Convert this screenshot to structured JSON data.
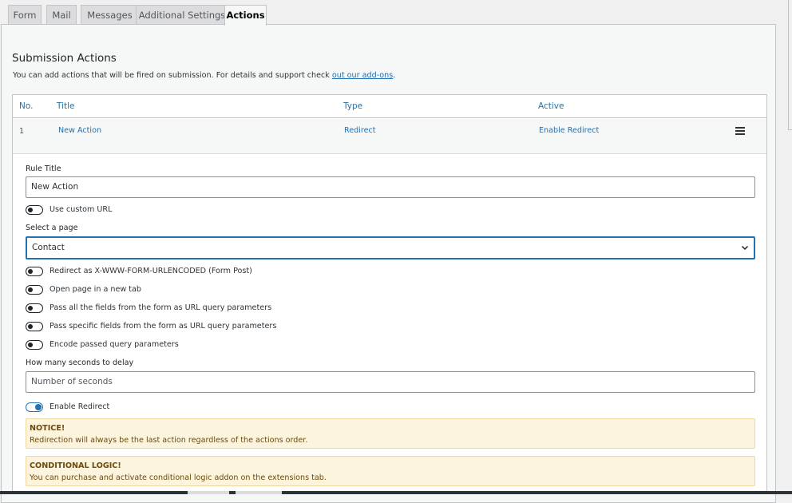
{
  "tabs": [
    {
      "label": "Form"
    },
    {
      "label": "Mail"
    },
    {
      "label": "Messages"
    },
    {
      "label": "Additional Settings"
    },
    {
      "label": "Actions"
    }
  ],
  "section": {
    "title": "Submission Actions",
    "description": "You can add actions that will be fired on submission. For details and support check ",
    "link_text": "out our add-ons",
    "description_end": "."
  },
  "table": {
    "headers": [
      "No.",
      "Title",
      "Type",
      "Active"
    ],
    "row": {
      "no": "1",
      "title": "New Action",
      "type": "Redirect",
      "active": "Enable Redirect"
    }
  },
  "editor": {
    "rule_title_label": "Rule Title",
    "rule_title_value": "New Action",
    "custom_url_label": "Use custom URL",
    "select_page_label": "Select a page",
    "select_page_value": "Contact",
    "toggles": [
      "Redirect as X-WWW-FORM-URLENCODED (Form Post)",
      "Open page in a new tab",
      "Pass all the fields from the form as URL query parameters",
      "Pass specific fields from the form as URL query parameters",
      "Encode passed query parameters"
    ],
    "delay_label": "How many seconds to delay",
    "delay_placeholder": "Number of seconds",
    "enable_redirect_label": "Enable Redirect",
    "enable_redirect_on": true,
    "notice": {
      "title": "NOTICE!",
      "body": "Redirection will always be the last action regardless of the actions order."
    },
    "conditional": {
      "title": "CONDITIONAL LOGIC!",
      "body": "You can purchase and activate conditional logic addon on the extensions tab."
    }
  },
  "colors": {
    "accent": "#2271b1",
    "notice_bg": "#fcf4dc"
  }
}
